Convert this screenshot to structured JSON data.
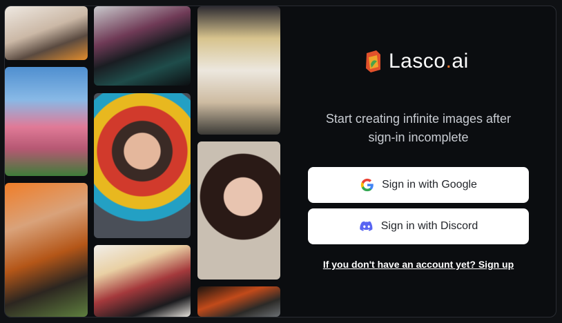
{
  "brand": {
    "name_main": "Lasco",
    "name_dot": ".",
    "name_suffix": "ai",
    "accent": "#f0742a"
  },
  "tagline": {
    "line1": "Start creating infinite images after",
    "line2": "sign-in incomplete"
  },
  "buttons": {
    "google": {
      "label": "Sign in with Google",
      "icon": "google-icon"
    },
    "discord": {
      "label": "Sign in with Discord",
      "icon": "discord-icon",
      "icon_color": "#5865f2"
    }
  },
  "signup_link": "If you don't have an account yet? Sign up"
}
